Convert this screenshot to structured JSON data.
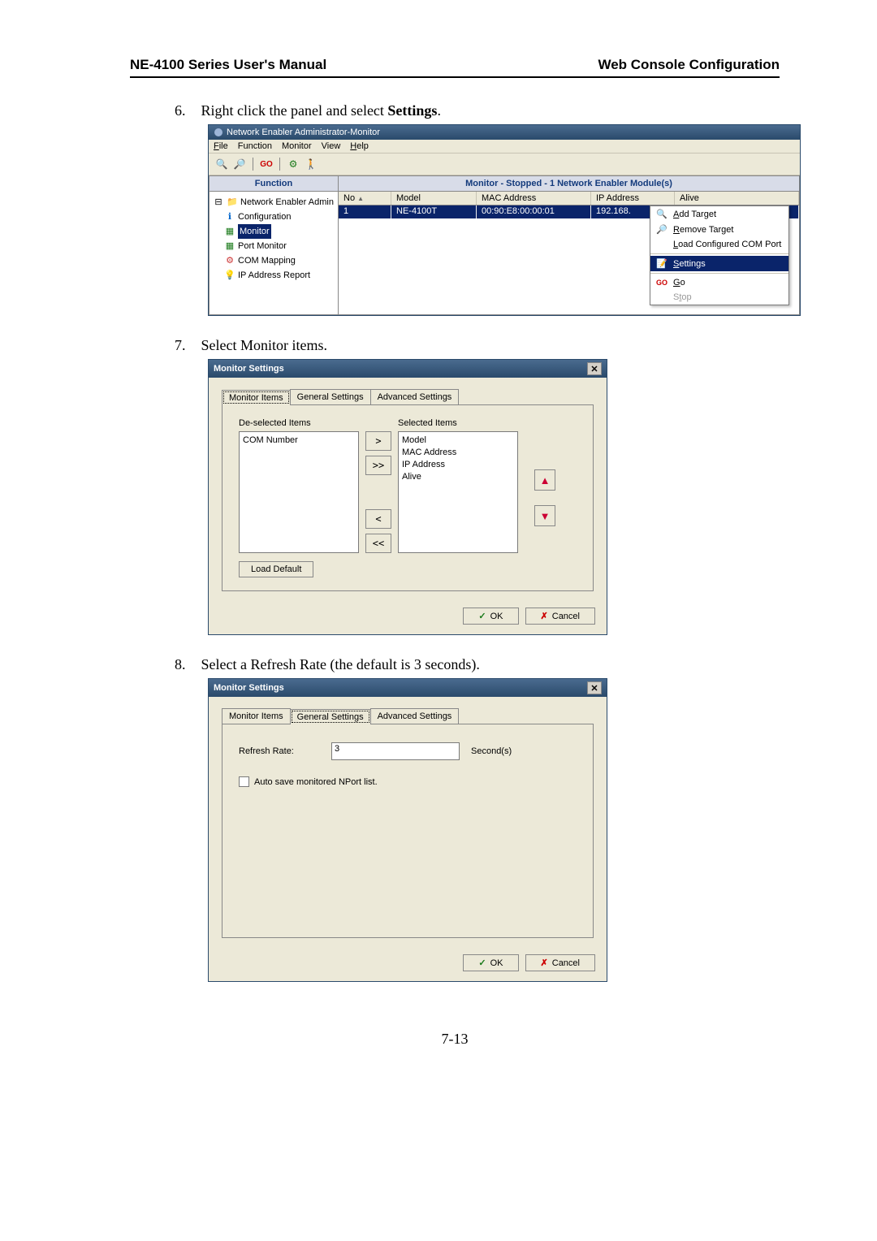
{
  "header": {
    "left": "NE-4100 Series User's Manual",
    "right": "Web Console Configuration"
  },
  "steps": {
    "s6_num": "6.",
    "s6_text_a": "Right click the panel and select ",
    "s6_text_b": "Settings",
    "s6_text_c": ".",
    "s7_num": "7.",
    "s7_text": "Select Monitor items.",
    "s8_num": "8.",
    "s8_text": "Select a Refresh Rate (the default is 3 seconds)."
  },
  "app": {
    "title": "Network Enabler Administrator-Monitor",
    "menu": {
      "file": "File",
      "function": "Function",
      "monitor": "Monitor",
      "view": "View",
      "help": "Help"
    },
    "func_header": "Function",
    "tree": {
      "root": "Network Enabler Admin",
      "config": "Configuration",
      "monitor": "Monitor",
      "port_monitor": "Port Monitor",
      "com_mapping": "COM Mapping",
      "ip_report": "IP Address Report"
    },
    "right_header": "Monitor - Stopped - 1 Network Enabler Module(s)",
    "cols": {
      "no": "No",
      "model": "Model",
      "mac": "MAC Address",
      "ip": "IP Address",
      "alive": "Alive"
    },
    "row": {
      "no": "1",
      "model": "NE-4100T",
      "mac": "00:90:E8:00:00:01",
      "ip": "192.168."
    },
    "ctx": {
      "add": "Add Target",
      "remove": "Remove Target",
      "load": "Load Configured COM Port",
      "settings": "Settings",
      "go": "Go",
      "stop": "Stop"
    }
  },
  "dlg1": {
    "title": "Monitor Settings",
    "tab1": "Monitor Items",
    "tab2": "General Settings",
    "tab3": "Advanced Settings",
    "deselected_label": "De-selected Items",
    "selected_label": "Selected Items",
    "deselected_items": [
      "COM Number"
    ],
    "selected_items": [
      "Model",
      "MAC Address",
      "IP Address",
      "Alive"
    ],
    "btn_right": ">",
    "btn_right_all": ">>",
    "btn_left": "<",
    "btn_left_all": "<<",
    "load_default": "Load Default",
    "ok": "OK",
    "cancel": "Cancel"
  },
  "dlg2": {
    "title": "Monitor Settings",
    "tab1": "Monitor Items",
    "tab2": "General Settings",
    "tab3": "Advanced Settings",
    "refresh_label": "Refresh Rate:",
    "refresh_value": "3",
    "seconds": "Second(s)",
    "auto_save": "Auto save monitored NPort list.",
    "ok": "OK",
    "cancel": "Cancel"
  },
  "page_num": "7-13"
}
